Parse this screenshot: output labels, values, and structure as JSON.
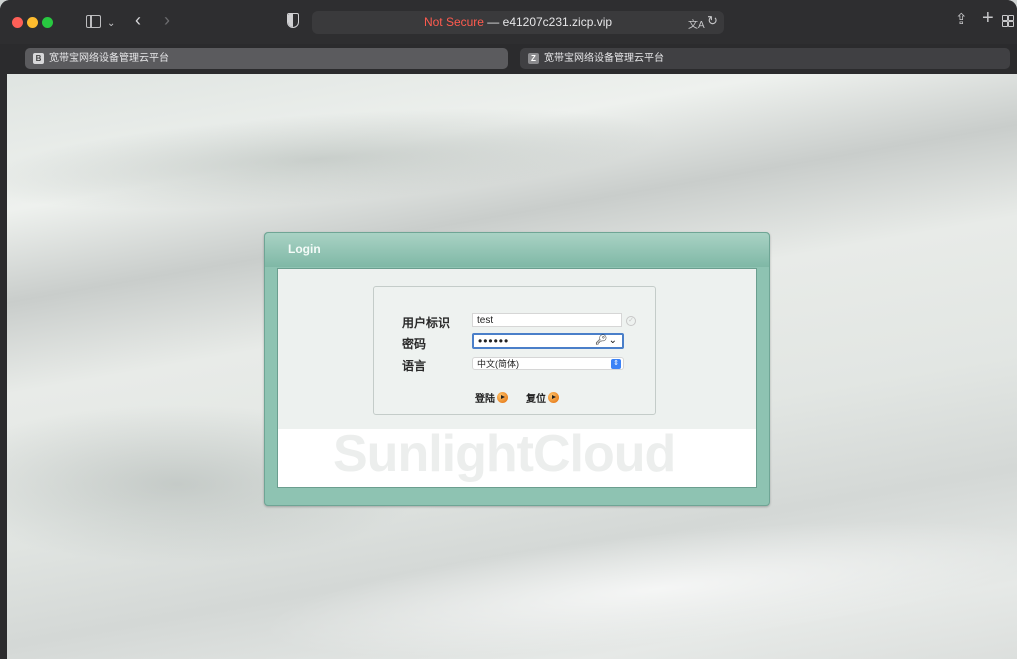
{
  "browser": {
    "address_prefix": "Not Secure",
    "address_separator": " — ",
    "address_host": "e41207c231.zicp.vip",
    "tabs": [
      {
        "label": "宽带宝网络设备管理云平台",
        "favicon": "B",
        "active": true
      },
      {
        "label": "宽带宝网络设备管理云平台",
        "favicon": "Z",
        "active": false
      }
    ]
  },
  "login": {
    "title": "Login",
    "username_label": "用户标识",
    "username_value": "test",
    "password_label": "密码",
    "password_value": "••••••",
    "language_label": "语言",
    "language_value": "中文(简体)",
    "login_button": "登陆",
    "reset_button": "复位",
    "brand_watermark": "SunlightCloud"
  },
  "colors": {
    "panel_green": "#8ec3b2",
    "not_secure_red": "#ff5b4f",
    "focus_blue": "#4a7fc9"
  }
}
